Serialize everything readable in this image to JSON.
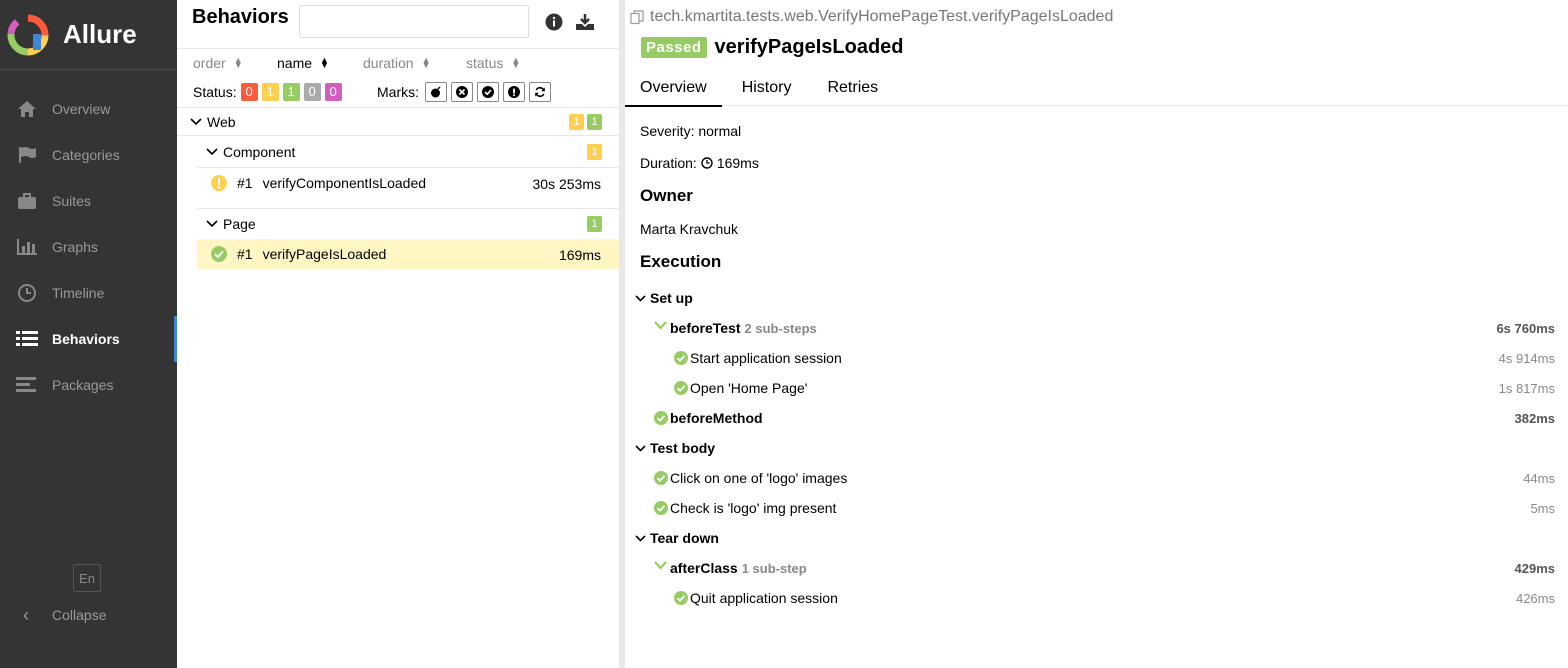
{
  "app": {
    "name": "Allure"
  },
  "sidebar": {
    "items": [
      {
        "label": "Overview",
        "icon": "home-icon"
      },
      {
        "label": "Categories",
        "icon": "flag-icon"
      },
      {
        "label": "Suites",
        "icon": "briefcase-icon"
      },
      {
        "label": "Graphs",
        "icon": "bar-chart-icon"
      },
      {
        "label": "Timeline",
        "icon": "clock-icon"
      },
      {
        "label": "Behaviors",
        "icon": "list-icon",
        "active": true
      },
      {
        "label": "Packages",
        "icon": "align-left-icon"
      }
    ],
    "language": "En",
    "collapse_label": "Collapse"
  },
  "behaviors": {
    "title": "Behaviors",
    "search_placeholder": "",
    "sort": {
      "order": "order",
      "name": "name",
      "duration": "duration",
      "status": "status"
    },
    "status_label": "Status:",
    "status_counts": {
      "failed": "0",
      "broken": "1",
      "passed": "1",
      "skipped": "0",
      "unknown": "0"
    },
    "marks_label": "Marks:",
    "tree": {
      "web": {
        "label": "Web",
        "broken": "1",
        "passed": "1"
      },
      "component": {
        "label": "Component",
        "broken": "1"
      },
      "component_test": {
        "num": "#1",
        "name": "verifyComponentIsLoaded",
        "duration": "30s 253ms"
      },
      "page": {
        "label": "Page",
        "passed": "1"
      },
      "page_test": {
        "num": "#1",
        "name": "verifyPageIsLoaded",
        "duration": "169ms"
      }
    }
  },
  "test": {
    "full_name": "tech.kmartita.tests.web.VerifyHomePageTest.verifyPageIsLoaded",
    "status": "Passed",
    "name": "verifyPageIsLoaded",
    "tabs": [
      "Overview",
      "History",
      "Retries"
    ],
    "severity": "Severity: normal",
    "duration_label": "Duration:",
    "duration": "169ms",
    "owner_heading": "Owner",
    "owner": "Marta Kravchuk",
    "execution_heading": "Execution",
    "setup": {
      "label": "Set up",
      "before_test": {
        "name": "beforeTest",
        "sub": "2 sub-steps",
        "duration": "6s 760ms"
      },
      "step1": {
        "name": "Start application session",
        "duration": "4s 914ms"
      },
      "step2": {
        "name": "Open 'Home Page'",
        "duration": "1s 817ms"
      },
      "before_method": {
        "name": "beforeMethod",
        "duration": "382ms"
      }
    },
    "body": {
      "label": "Test body",
      "step1": {
        "name": "Click on one of 'logo' images",
        "duration": "44ms"
      },
      "step2": {
        "name": "Check is 'logo' img present",
        "duration": "5ms"
      }
    },
    "teardown": {
      "label": "Tear down",
      "after_class": {
        "name": "afterClass",
        "sub": "1 sub-step",
        "duration": "429ms"
      },
      "step1": {
        "name": "Quit application session",
        "duration": "426ms"
      }
    }
  },
  "colors": {
    "passed": "#97cc64",
    "broken": "#ffd050",
    "failed": "#fd5a3e",
    "skipped": "#aaaaaa",
    "unknown": "#d35ebe",
    "sidebar": "#343434",
    "selected": "#fff6c3"
  }
}
